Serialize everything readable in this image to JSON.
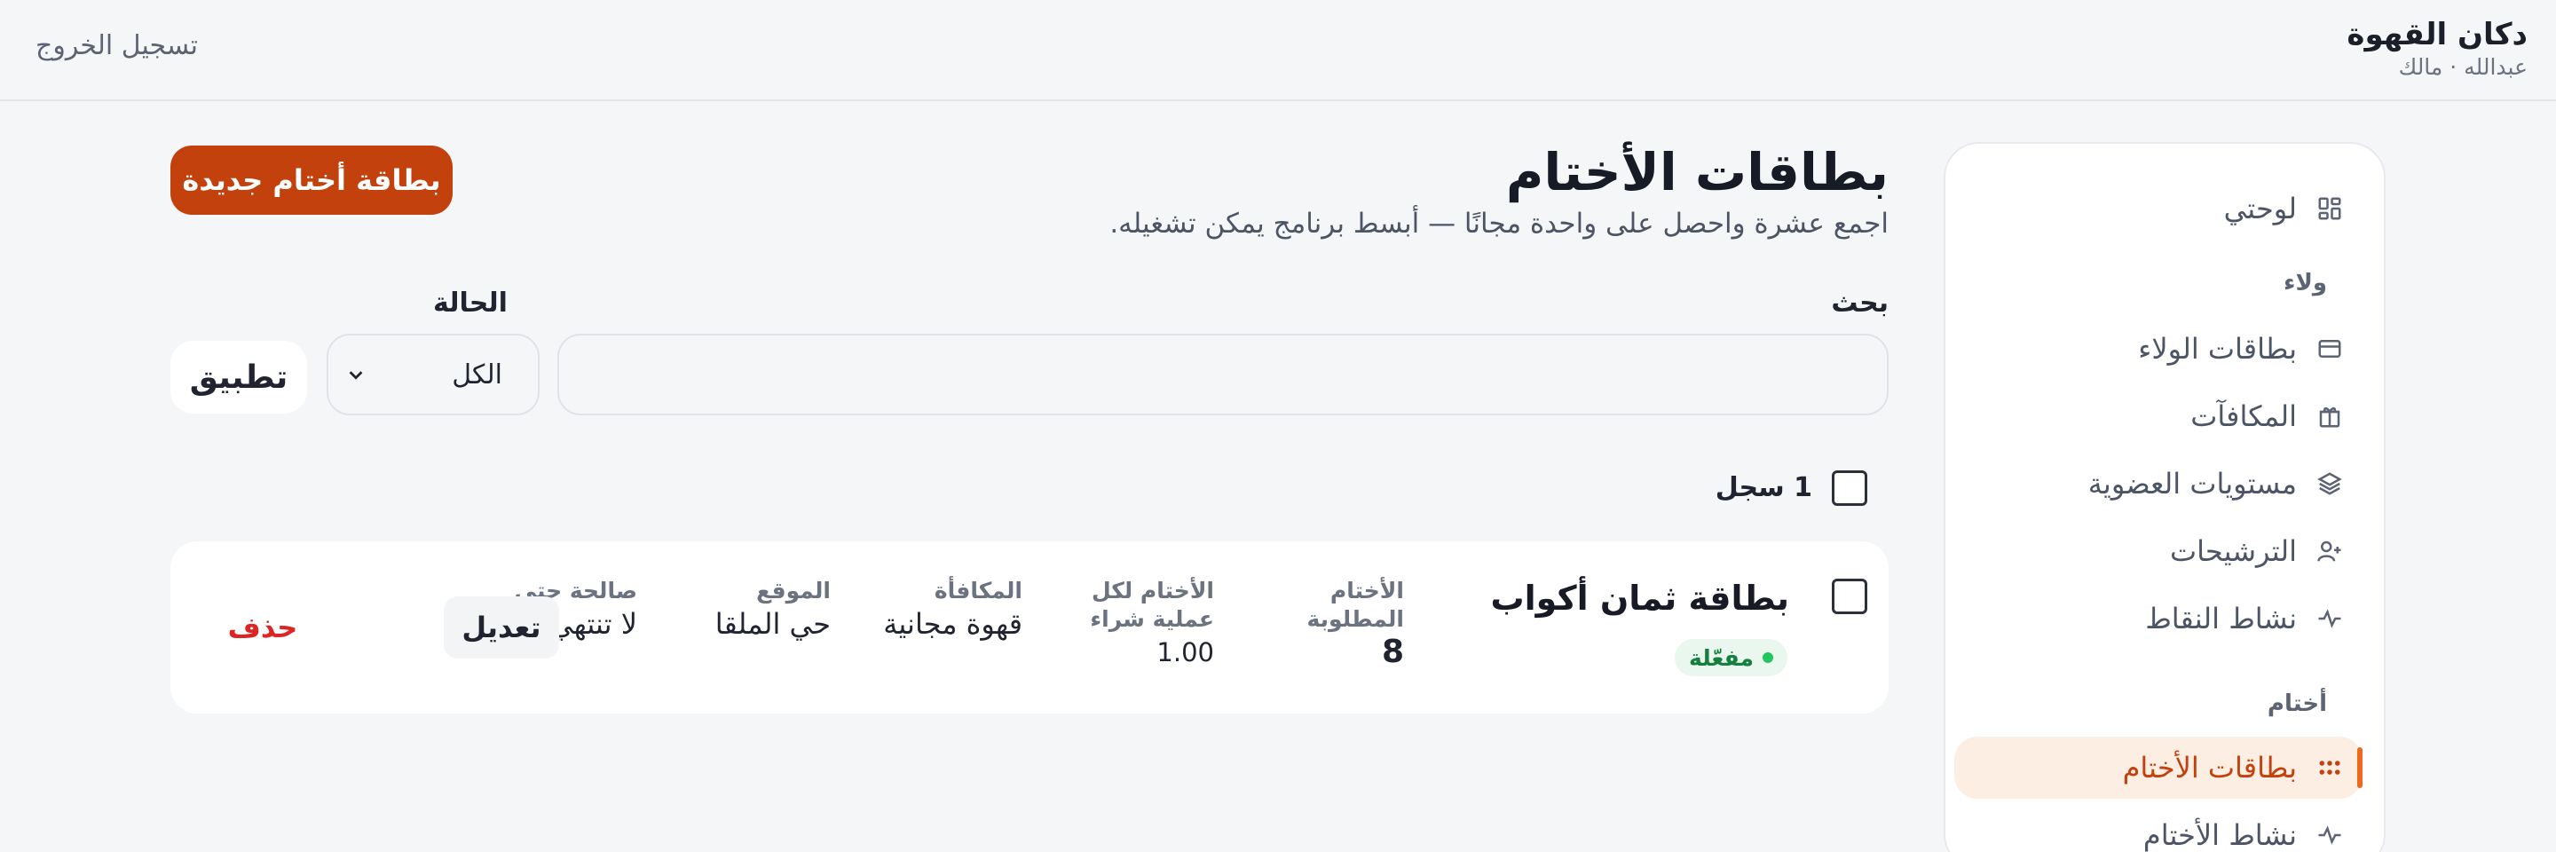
{
  "header": {
    "brand": "دكان القهوة",
    "user_line": "عبدالله · مالك",
    "logout": "تسجيل الخروج"
  },
  "sidebar": {
    "dashboard": "لوحتي",
    "group_loyalty": "ولاء",
    "loyalty_cards": "بطاقات الولاء",
    "rewards": "المكافآت",
    "tiers": "مستويات العضوية",
    "referrals": "الترشيحات",
    "points_activity": "نشاط النقاط",
    "group_stamps": "أختام",
    "stamp_cards": "بطاقات الأختام",
    "stamp_activity": "نشاط الأختام"
  },
  "main": {
    "title": "بطاقات الأختام",
    "subtitle": "اجمع عشرة واحصل على واحدة مجانًا — أبسط برنامج يمكن تشغيله.",
    "new_button": "بطاقة أختام جديدة",
    "search_label": "بحث",
    "search_value": "",
    "status_label": "الحالة",
    "status_value": "الكل",
    "apply_button": "تطبيق",
    "count": "1 سجل"
  },
  "cards": [
    {
      "name": "بطاقة ثمان أكواب",
      "status": "مفعّلة",
      "required_header": "الأختام المطلوبة",
      "required_value": "8",
      "per_purchase_header": "الأختام لكل عملية شراء",
      "per_purchase_value": "1.00",
      "reward_header": "المكافأة",
      "reward_value": "قهوة مجانية",
      "location_header": "الموقع",
      "location_value": "حي الملقا",
      "valid_header": "صالحة حتى",
      "valid_value": "لا تنتهي",
      "edit": "تعديل",
      "delete": "حذف"
    }
  ],
  "colors": {
    "accent": "#c2410c",
    "active_bg": "#fdeee3",
    "danger": "#dc2626",
    "success": "#15803d"
  },
  "icons": {
    "dashboard": "dashboard-icon",
    "loyalty_cards": "card-icon",
    "rewards": "gift-icon",
    "tiers": "layers-icon",
    "referrals": "user-plus-icon",
    "activity": "pulse-icon",
    "stamp_cards": "stamps-grid-icon",
    "select": "chevron-down-icon"
  }
}
